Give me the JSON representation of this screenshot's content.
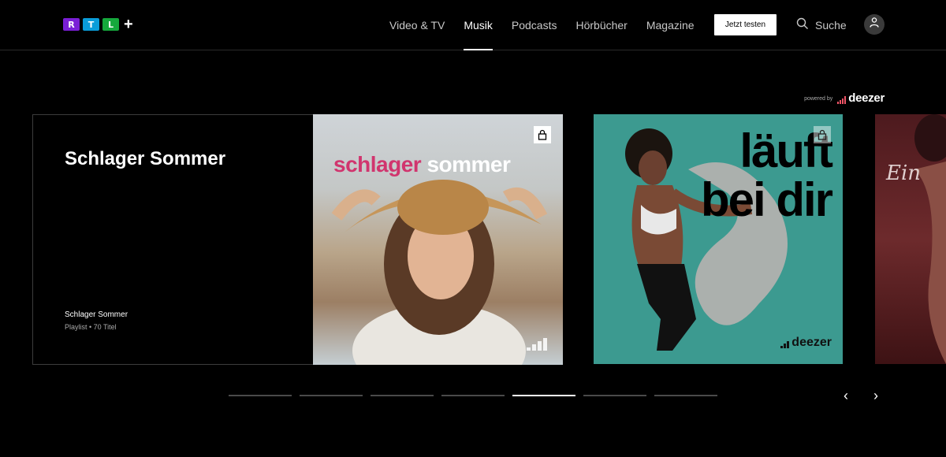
{
  "logo": {
    "letters": [
      "R",
      "T",
      "L"
    ],
    "colors": [
      "#7a1fd6",
      "#0a9dd9",
      "#15a83c"
    ],
    "plus": "+"
  },
  "nav": {
    "items": [
      {
        "label": "Video & TV",
        "active": false
      },
      {
        "label": "Musik",
        "active": true
      },
      {
        "label": "Podcasts",
        "active": false
      },
      {
        "label": "Hörbücher",
        "active": false
      },
      {
        "label": "Magazine",
        "active": false
      }
    ],
    "try_label": "Jetzt testen",
    "search_label": "Suche"
  },
  "powered": {
    "text": "powered by",
    "brand": "deezer"
  },
  "hero": {
    "title": "Schlager Sommer",
    "name": "Schlager Sommer",
    "subtitle": "Playlist • 70 Titel",
    "cover_title_pink": "schlager",
    "cover_title_white": "sommer"
  },
  "card2": {
    "line1": "läuft",
    "line2": "bei dir",
    "brand": "deezer"
  },
  "card3": {
    "text": "Ein"
  },
  "pager": {
    "count": 7,
    "active_index": 4
  },
  "arrows": {
    "prev": "‹",
    "next": "›"
  }
}
